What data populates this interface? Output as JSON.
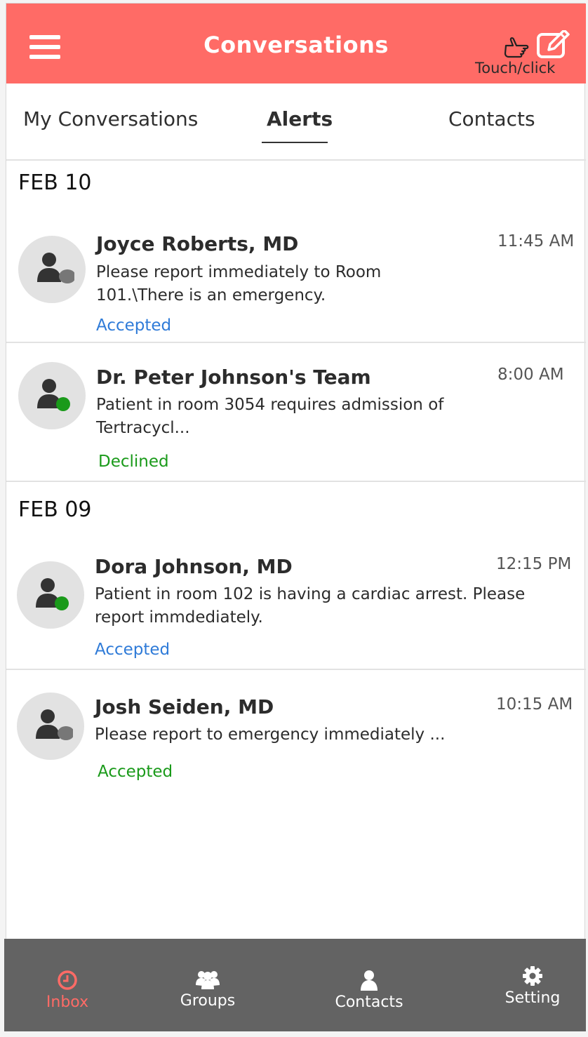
{
  "header": {
    "title": "Conversations",
    "touch_label": "Touch/click",
    "menu_icon": "hamburger-menu-icon",
    "hand_icon": "pointing-hand-icon",
    "compose_icon": "compose-edit-icon"
  },
  "tabs": [
    {
      "label": "My Conversations",
      "active": false
    },
    {
      "label": "Alerts",
      "active": true
    },
    {
      "label": "Contacts",
      "active": false
    }
  ],
  "groups": [
    {
      "date": "FEB 10",
      "items": [
        {
          "name": "Joyce  Roberts, MD",
          "time": "11:45 AM",
          "message": "Please report immediately to Room 101.\\There is an emergency.",
          "status": "Accepted",
          "status_color": "#2f7bd8",
          "presence": "offline"
        },
        {
          "name": "Dr. Peter Johnson's Team",
          "time": "8:00 AM",
          "message": "Patient in room 3054 requires admission of Tertracycl...",
          "status": "Declined",
          "status_color": "#1a9a1a",
          "presence": "online"
        }
      ]
    },
    {
      "date": "FEB 09",
      "items": [
        {
          "name": "Dora Johnson, MD",
          "time": "12:15 PM",
          "message": "Patient in room 102 is having a cardiac arrest. Please report immdediately.",
          "status": "Accepted",
          "status_color": "#2f7bd8",
          "presence": "online"
        },
        {
          "name": "Josh Seiden, MD",
          "time": "10:15 AM",
          "message": "Please report to emergency immediately ...",
          "status": "Accepted",
          "status_color": "#1a9a1a",
          "presence": "offline"
        }
      ]
    }
  ],
  "bottom_nav": [
    {
      "label": "Inbox",
      "icon": "clock-icon",
      "active": true
    },
    {
      "label": "Groups",
      "icon": "group-icon",
      "active": false
    },
    {
      "label": "Contacts",
      "icon": "person-icon",
      "active": false
    },
    {
      "label": "Setting",
      "icon": "gear-icon",
      "active": false
    }
  ],
  "colors": {
    "brand": "#ff6b66",
    "nav_background": "#636363",
    "presence_online": "#1a9a1a",
    "presence_offline": "#777777"
  }
}
